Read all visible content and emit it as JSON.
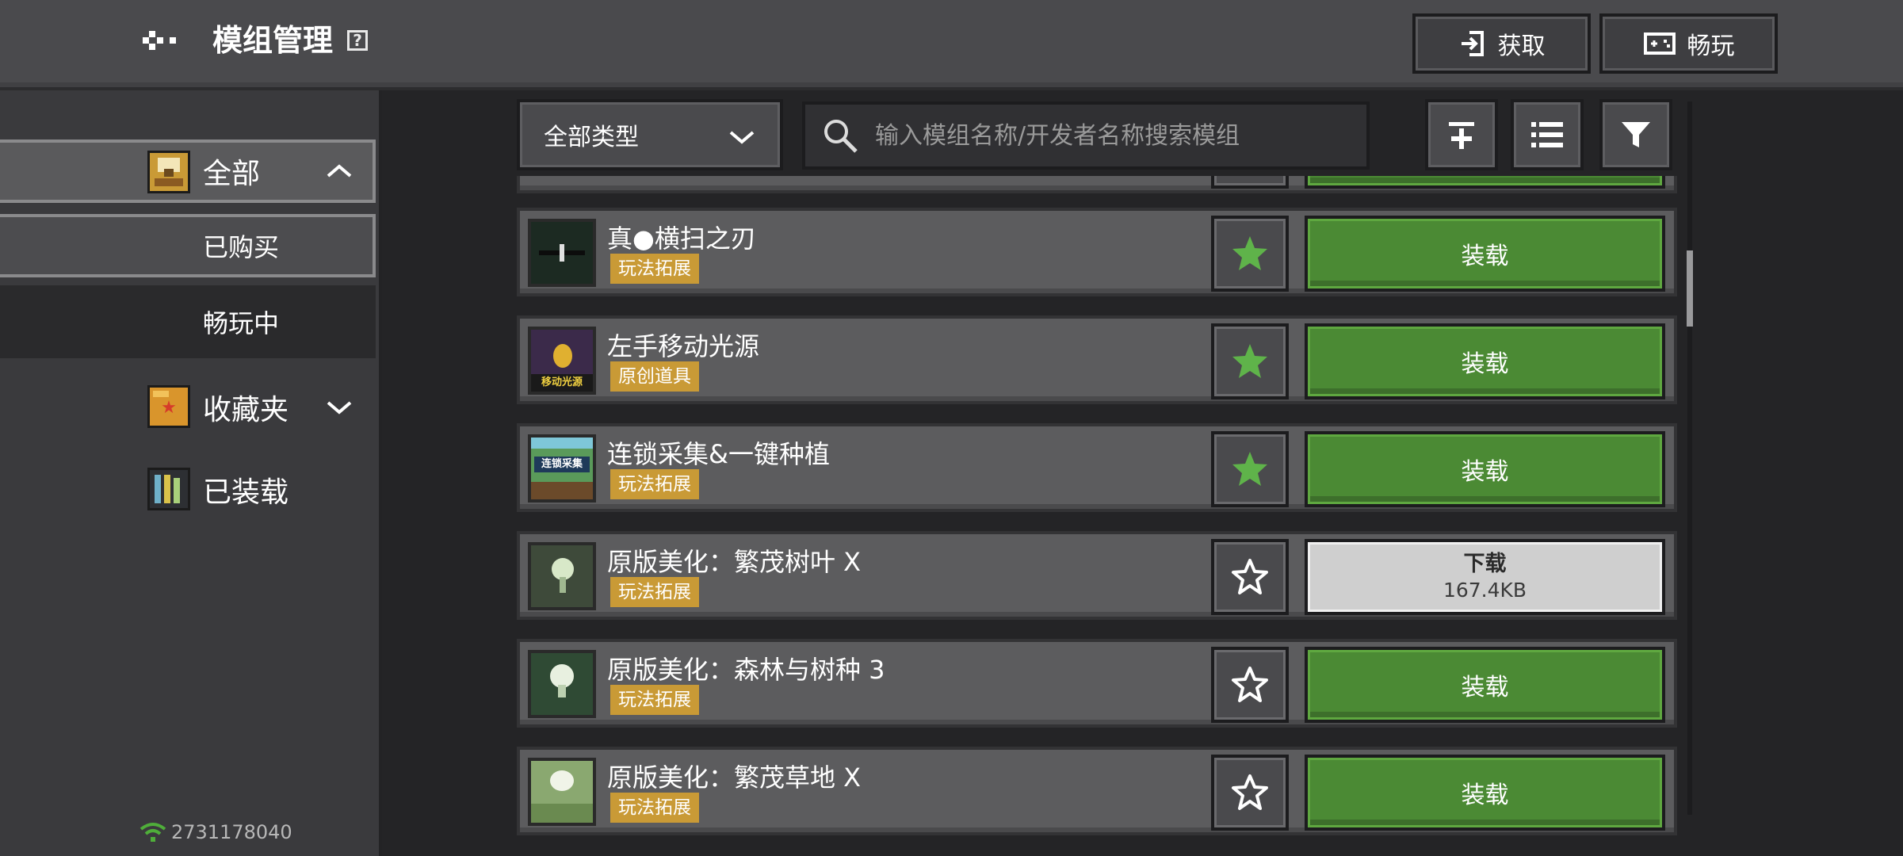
{
  "header": {
    "title": "模组管理",
    "help_glyph": "?",
    "get_label": "获取",
    "play_label": "畅玩"
  },
  "sidebar": {
    "items": [
      {
        "label": "全部",
        "icon": "chest-icon"
      },
      {
        "label": "已购买"
      },
      {
        "label": "畅玩中"
      },
      {
        "label": "收藏夹",
        "icon": "folder-star-icon"
      },
      {
        "label": "已装载",
        "icon": "bookshelf-icon"
      }
    ],
    "user_id": "2731178040"
  },
  "toolbar": {
    "type_filter": "全部类型",
    "search_placeholder": "输入模组名称/开发者名称搜索模组"
  },
  "mods": [
    {
      "name": "真●横扫之刃",
      "tag": "玩法拓展",
      "favorited": true,
      "action": "装载"
    },
    {
      "name": "左手移动光源",
      "tag": "原创道具",
      "favorited": true,
      "action": "装载",
      "thumb_text": "移动光源"
    },
    {
      "name": "连锁采集&一键种植",
      "tag": "玩法拓展",
      "favorited": true,
      "action": "装载",
      "thumb_text": "连锁采集"
    },
    {
      "name": "原版美化：繁茂树叶 X",
      "tag": "玩法拓展",
      "favorited": false,
      "action": "下载",
      "size": "167.4KB"
    },
    {
      "name": "原版美化：森林与树种 3",
      "tag": "玩法拓展",
      "favorited": false,
      "action": "装载"
    },
    {
      "name": "原版美化：繁茂草地 X",
      "tag": "玩法拓展",
      "favorited": false,
      "action": "装载"
    }
  ],
  "colors": {
    "accent_green": "#4b8a34",
    "tag_gold": "#c99a36",
    "star_green": "#5fb34a"
  }
}
